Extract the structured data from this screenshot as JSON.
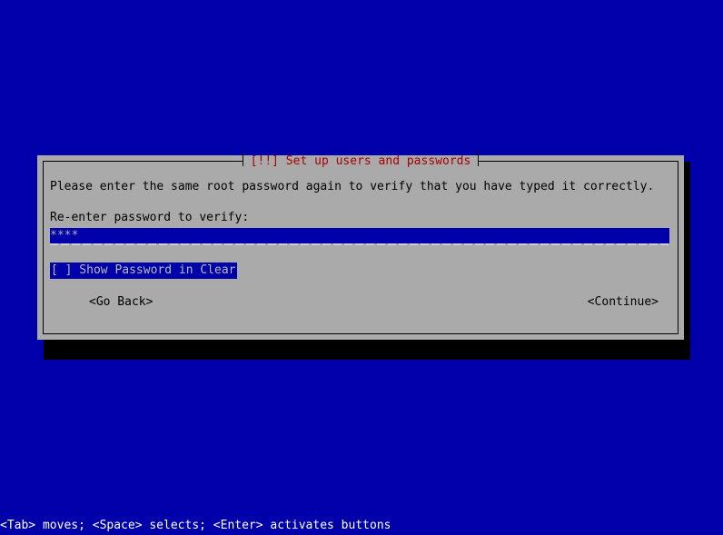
{
  "screen": {
    "background_color": "#0000aa",
    "foreground_color": "#ffffff"
  },
  "dialog": {
    "title": "[!!] Set up users and passwords",
    "title_color": "#aa0000",
    "background_color": "#aaaaaa",
    "border_color": "#000000",
    "shadow_color": "#000000",
    "prompt": "Please enter the same root password again to verify that you have typed it correctly.",
    "field_label": "Re-enter password to verify:",
    "password_input": {
      "value": "****",
      "masked": true,
      "highlight_color": "#0000aa",
      "text_color": "#aaaaaa"
    },
    "checkbox": {
      "label": "[ ] Show Password in Clear",
      "checked": false,
      "focused": true,
      "highlight_color": "#0000aa",
      "text_color": "#bbbbbb"
    },
    "buttons": [
      {
        "label": "<Go Back>",
        "focused": false
      },
      {
        "label": "<Continue>",
        "focused": false
      }
    ]
  },
  "status_bar": {
    "text": "<Tab> moves; <Space> selects; <Enter> activates buttons"
  }
}
